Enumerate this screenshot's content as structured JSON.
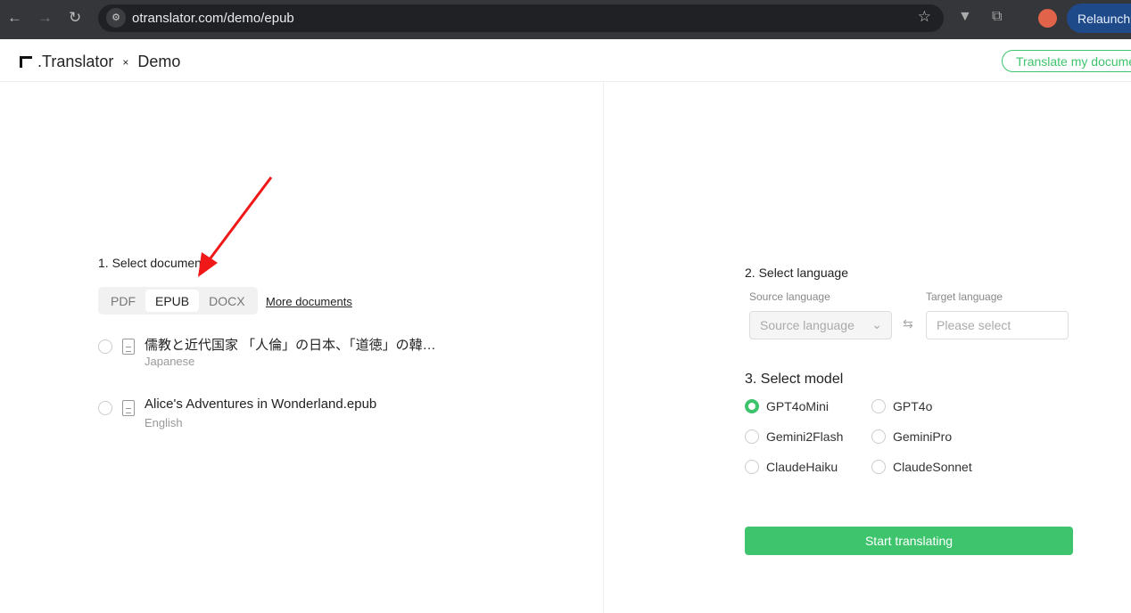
{
  "browser": {
    "url": "otranslator.com/demo/epub",
    "relaunch": "Relaunch"
  },
  "header": {
    "logo": ".Translator",
    "x": "×",
    "demo": "Demo",
    "cta": "Translate my documents"
  },
  "documents": {
    "title": "1. Select document",
    "tabs": [
      "PDF",
      "EPUB",
      "DOCX"
    ],
    "active_tab": "EPUB",
    "more": "More documents",
    "items": [
      {
        "name": "儒教と近代国家 「人倫」の日本、「道徳」の韓…",
        "lang": "Japanese"
      },
      {
        "name": "Alice's Adventures in Wonderland.epub",
        "lang": "English"
      }
    ]
  },
  "language": {
    "title": "2. Select language",
    "source_label": "Source language",
    "source_value": "Source language",
    "target_label": "Target language",
    "target_placeholder": "Please select"
  },
  "model": {
    "title": "3. Select model",
    "options": [
      "GPT4oMini",
      "GPT4o",
      "Gemini2Flash",
      "GeminiPro",
      "ClaudeHaiku",
      "ClaudeSonnet"
    ],
    "selected": "GPT4oMini"
  },
  "start": "Start translating",
  "colors": {
    "accent": "#3ec46d",
    "arrow": "#f01818"
  }
}
